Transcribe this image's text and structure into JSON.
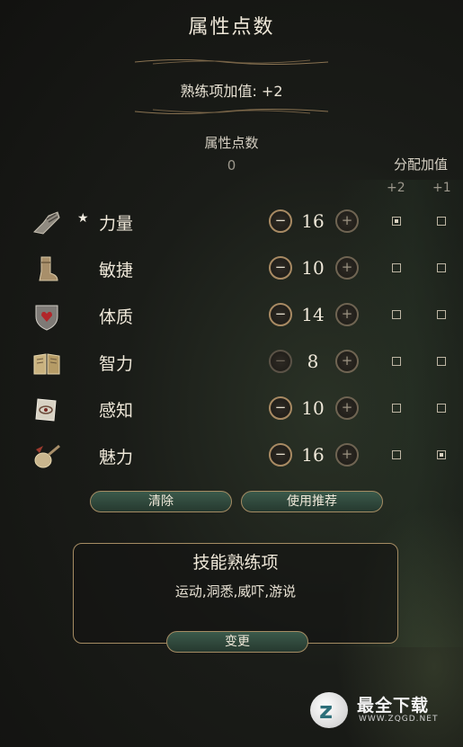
{
  "header": {
    "title": "属性点数",
    "proficiency_bonus": "熟练项加值: +2"
  },
  "points": {
    "label": "属性点数",
    "value": "0"
  },
  "allocation": {
    "header": "分配加值",
    "col_plus2": "+2",
    "col_plus1": "+1"
  },
  "attributes": [
    {
      "name": "力量",
      "value": "16",
      "starred": true,
      "plus2": true,
      "plus1": false,
      "minus_enabled": true,
      "icon": "gauntlet-icon"
    },
    {
      "name": "敏捷",
      "value": "10",
      "starred": false,
      "plus2": false,
      "plus1": false,
      "minus_enabled": true,
      "icon": "boot-icon"
    },
    {
      "name": "体质",
      "value": "14",
      "starred": false,
      "plus2": false,
      "plus1": false,
      "minus_enabled": true,
      "icon": "heart-shield-icon"
    },
    {
      "name": "智力",
      "value": "8",
      "starred": false,
      "plus2": false,
      "plus1": false,
      "minus_enabled": false,
      "icon": "book-icon"
    },
    {
      "name": "感知",
      "value": "10",
      "starred": false,
      "plus2": false,
      "plus1": false,
      "minus_enabled": true,
      "icon": "eye-scroll-icon"
    },
    {
      "name": "魅力",
      "value": "16",
      "starred": false,
      "plus2": false,
      "plus1": true,
      "minus_enabled": true,
      "icon": "lute-icon"
    }
  ],
  "buttons": {
    "clear": "清除",
    "recommend": "使用推荐",
    "change": "变更",
    "minus_glyph": "−",
    "plus_glyph": "+"
  },
  "skills": {
    "title": "技能熟练项",
    "list": "运动,洞悉,威吓,游说"
  },
  "watermark": {
    "logo_letter": "z",
    "text": "最全下载",
    "url": "WWW.ZQGD.NET"
  },
  "colors": {
    "accent_gold": "#a58c63",
    "pill_green": "#3b5a4b"
  }
}
